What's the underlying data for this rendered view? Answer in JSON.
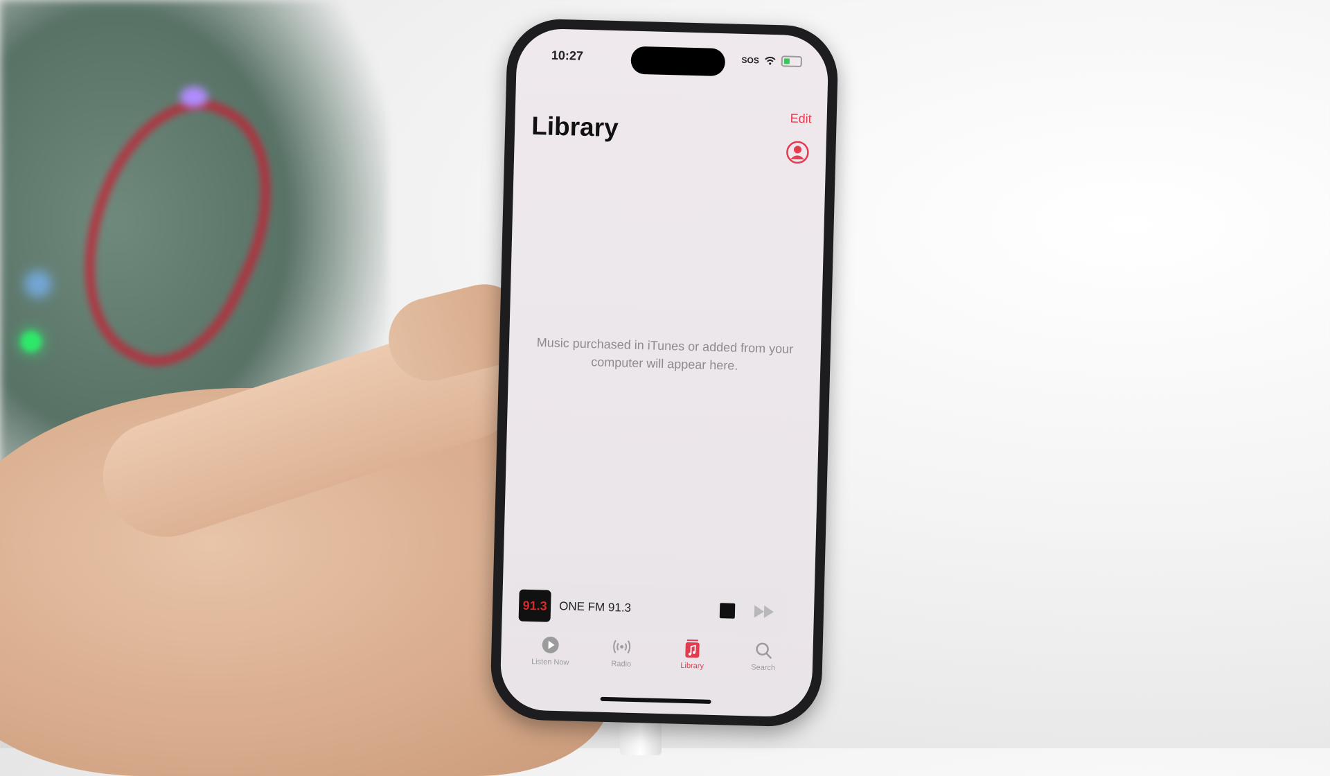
{
  "status_bar": {
    "time": "10:27",
    "carrier": "SOS"
  },
  "header": {
    "title": "Library",
    "edit_label": "Edit"
  },
  "library": {
    "empty_message": "Music purchased in iTunes or added from your computer will appear here."
  },
  "now_playing": {
    "artwork_text": "91.3",
    "station_name": "ONE FM 91.3"
  },
  "tabbar": {
    "items": [
      {
        "label": "Listen Now",
        "icon": "play-circle-icon",
        "active": false
      },
      {
        "label": "Radio",
        "icon": "radio-waves-icon",
        "active": false
      },
      {
        "label": "Library",
        "icon": "music-note-icon",
        "active": true
      },
      {
        "label": "Search",
        "icon": "search-icon",
        "active": false
      }
    ]
  },
  "colors": {
    "accent": "#e33b4f",
    "inactive_tab": "#9b9b9b"
  }
}
